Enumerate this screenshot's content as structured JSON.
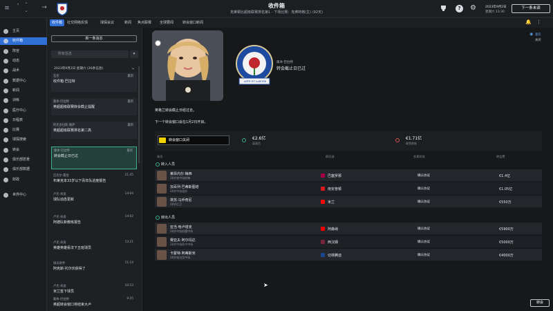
{
  "topbar": {
    "title": "收件箱",
    "subtitle": "克莱顿比超级联赛排名第1 - 下场比赛：克弗特格(主) (92天)",
    "date": "2023年9月2日",
    "date_sub": "星期六 13:30",
    "continue": "下一条未读"
  },
  "tabs": [
    "收件箱",
    "社交网络反馈",
    "球探会议",
    "新闻",
    "焦点联赛",
    "全球要闻",
    "转会窗口新闻"
  ],
  "sidebar": [
    "主页",
    "收件箱",
    "阵容",
    "动态",
    "战术",
    "数据中心",
    "新闻",
    "训练",
    "医疗中心",
    "日程表",
    "比赛",
    "球探搜索",
    "转会",
    "俱乐部愿景",
    "俱乐部数据",
    "财政",
    "世界中心"
  ],
  "list": {
    "new_message": "新一条消息",
    "search_placeholder": "所有信息",
    "group_header": "2023年9月2日 星期六 (26条信息)",
    "messages": [
      {
        "from": "瓦伦",
        "time": "最新",
        "subject": "收件箱·巴拉特"
      },
      {
        "from": "集体·巴拉特",
        "time": "最新",
        "subject": "英超超级联赛转会截止提醒"
      },
      {
        "from": "阿克多拉斯·路萨",
        "time": "最新",
        "subject": "英超超级联赛排名第二高"
      },
      {
        "from": "集体·巴拉特",
        "time": "最新",
        "subject": "转会截止日已过"
      },
      {
        "from": "迈克尔·詹金",
        "time": "21:45",
        "subject": "布莱克本33岁以下青年队进度报告"
      },
      {
        "from": "卢克·肯迪",
        "time": "14:04",
        "subject": "球队动态更新"
      },
      {
        "from": "卢克·肯迪",
        "time": "14:02",
        "subject": "阿德队新教练报告"
      },
      {
        "from": "卢克·肯迪",
        "time": "13:21",
        "subject": "英雄英雄看法下五班球员"
      },
      {
        "from": "球员助手",
        "time": "11:14",
        "subject": "阿克斯·托尔伏获得了"
      },
      {
        "from": "卢克·肯迪",
        "time": "10:53",
        "subject": "米兰签下球员"
      },
      {
        "from": "集体·巴拉特",
        "time": "9:25",
        "subject": "英超转会窗口将结束大卢"
      }
    ]
  },
  "news": {
    "author": "集体·巴拉特",
    "title": "转会截止日已过",
    "crest_text": "ARTE ET LABORE",
    "line1": "英格兰转会截止日经过去。",
    "line2": "下一个转会窗口会在1月2日开启。",
    "close_label": "关闭",
    "preferences_label": "喜欢"
  },
  "summary": {
    "window_label": "转会窗口关闭",
    "spent_value": "€2.6亿",
    "spent_label": "英球员",
    "received_value": "€1.71亿",
    "received_label": "收到转账"
  },
  "table": {
    "headers": [
      "球员",
      "俱乐部",
      "交易状态",
      "转会费"
    ],
    "in_title": "转入人员",
    "out_title": "转出人员",
    "in": [
      {
        "name": "莱昂内尔·梅西",
        "desc": "28岁攻中场前锋",
        "club": "巴塞罗那",
        "status": "确认协议",
        "fee": "€1.4亿",
        "club_color": "#a50044"
      },
      {
        "name": "加百列·巴蒂斯图塔",
        "desc": "28岁中场组织",
        "club": "南安普顿",
        "status": "确认协议",
        "fee": "€1.05亿",
        "club_color": "#d71920"
      },
      {
        "name": "埃苏·马乔奇尼",
        "desc": "28岁后卫",
        "club": "米兰",
        "status": "确认协议",
        "fee": "€550万",
        "club_color": "#fb090b"
      }
    ],
    "out": [
      {
        "name": "亚当·哈卢塔克",
        "desc": "28岁中场前腰中场",
        "club": "阿森纳",
        "status": "确认协议",
        "fee": "€5900万",
        "club_color": "#ef0107"
      },
      {
        "name": "赛亚夫·阿尔玛达",
        "desc": "28岁中场防守中场",
        "club": "西汉姆",
        "status": "确认协议",
        "fee": "€5000万",
        "club_color": "#7a263a"
      },
      {
        "name": "卡蒙特·阿蒂斯米",
        "desc": "28岁攻击型中场",
        "club": "切林腾迪",
        "status": "确认协议",
        "fee": "€4000万",
        "club_color": "#1b458f"
      }
    ]
  },
  "bottom": {
    "continue": "转会"
  }
}
